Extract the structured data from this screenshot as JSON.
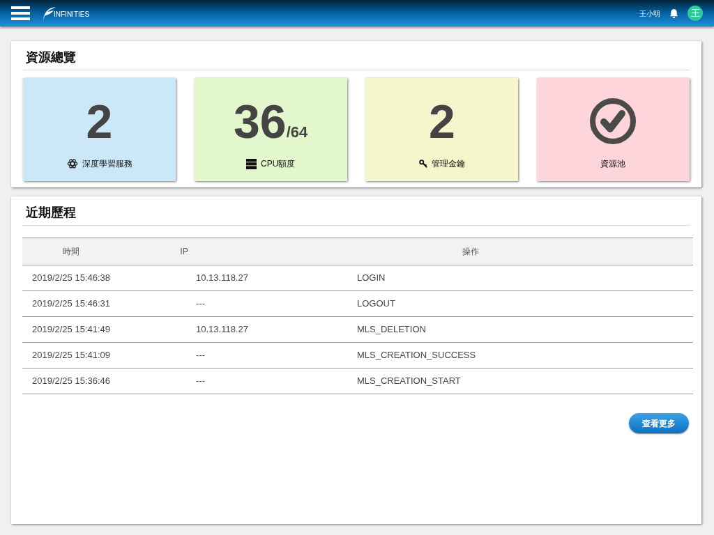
{
  "header": {
    "logo": "INFINITIES",
    "user_name": "王小明",
    "avatar": "王"
  },
  "overview": {
    "title": "資源總覽",
    "cards": [
      {
        "kind": "count",
        "value": "2",
        "label": "深度學習服務",
        "color": "#cce8f8"
      },
      {
        "kind": "ratio",
        "value": "36",
        "total": "/64",
        "label": "CPU額度",
        "color": "#e2f8cc"
      },
      {
        "kind": "count",
        "value": "2",
        "label": "管理金鑰",
        "color": "#f6f6cc"
      },
      {
        "kind": "status",
        "label": "資源池",
        "color": "#fdd5da"
      }
    ]
  },
  "history": {
    "title": "近期歷程",
    "columns": [
      "時間",
      "IP",
      "操作"
    ],
    "rows": [
      [
        "2019/2/25 15:46:38",
        "10.13.118.27",
        "LOGIN"
      ],
      [
        "2019/2/25 15:46:31",
        "---",
        "LOGOUT"
      ],
      [
        "2019/2/25 15:41:49",
        "10.13.118.27",
        "MLS_DELETION"
      ],
      [
        "2019/2/25 15:41:09",
        "---",
        "MLS_CREATION_SUCCESS"
      ],
      [
        "2019/2/25 15:36:46",
        "---",
        "MLS_CREATION_START"
      ]
    ],
    "more_button": "查看更多"
  }
}
